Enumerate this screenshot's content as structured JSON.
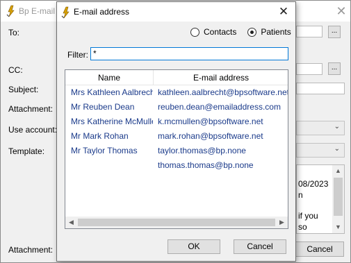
{
  "background_window": {
    "title": "Bp E-mail",
    "labels": {
      "to": "To:",
      "cc": "CC:",
      "subject": "Subject:",
      "attachment": "Attachment:",
      "use_account": "Use account:",
      "template": "Template:",
      "attachment_bottom": "Attachment:"
    },
    "browse_label": "...",
    "body_lines": [
      "08/2023",
      "n",
      "",
      "if you",
      "so"
    ],
    "cancel_label": "Cancel"
  },
  "dialog": {
    "title": "E-mail address",
    "radio": {
      "contacts_label": "Contacts",
      "patients_label": "Patients",
      "selected": "Patients"
    },
    "filter_label": "Filter:",
    "filter_value": "*",
    "columns": [
      "Name",
      "E-mail address"
    ],
    "rows": [
      {
        "name": "Mrs Kathleen Aalbrecht",
        "email": "kathleen.aalbrecht@bpsoftware.net"
      },
      {
        "name": "Mr Reuben Dean",
        "email": "reuben.dean@emailaddress.com"
      },
      {
        "name": "Mrs Katherine McMullen",
        "email": "k.mcmullen@bpsoftware.net"
      },
      {
        "name": "Mr Mark Rohan",
        "email": "mark.rohan@bpsoftware.net"
      },
      {
        "name": "Mr Taylor Thomas",
        "email": "taylor.thomas@bp.none"
      },
      {
        "name": "",
        "email": "thomas.thomas@bp.none"
      }
    ],
    "ok_label": "OK",
    "cancel_label": "Cancel"
  }
}
